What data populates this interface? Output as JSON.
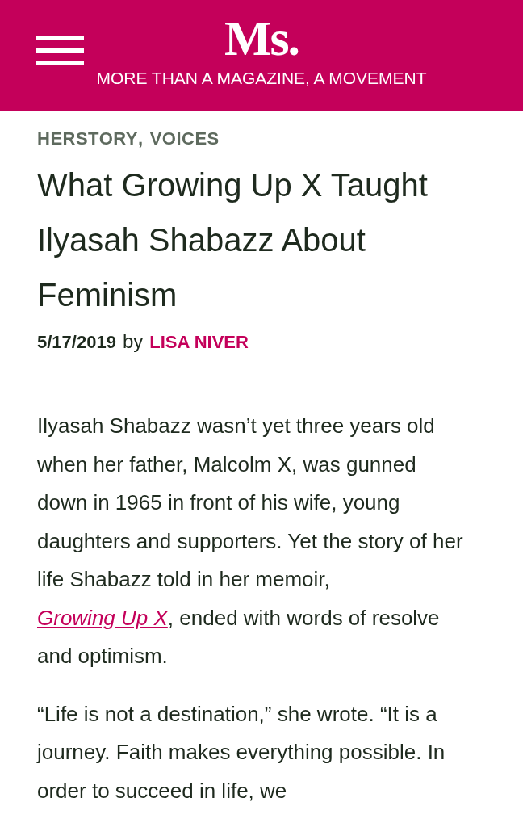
{
  "header": {
    "logo": "Ms.",
    "tagline": "MORE THAN A MAGAZINE, A MOVEMENT"
  },
  "categories": [
    "HERSTORY",
    "VOICES"
  ],
  "category_separator": ",",
  "article": {
    "title": "What Growing Up X Taught Ilyasah Shabazz About Feminism",
    "date": "5/17/2019",
    "by": "by",
    "author": "LISA NIVER",
    "paragraphs": [
      {
        "before": "Ilyasah Shabazz wasn’t yet three years old when her father, Malcolm X, was gunned down in 1965 in front of his wife, young daughters and supporters. Yet the story of her life Shabazz told in her memoir, ",
        "link": "Growing Up X",
        "after": ", ended with words of resolve and optimism."
      },
      {
        "before": "“Life is not a destination,” she wrote. “It is a journey. Faith makes everything possible. In order to succeed in life, we"
      }
    ]
  }
}
